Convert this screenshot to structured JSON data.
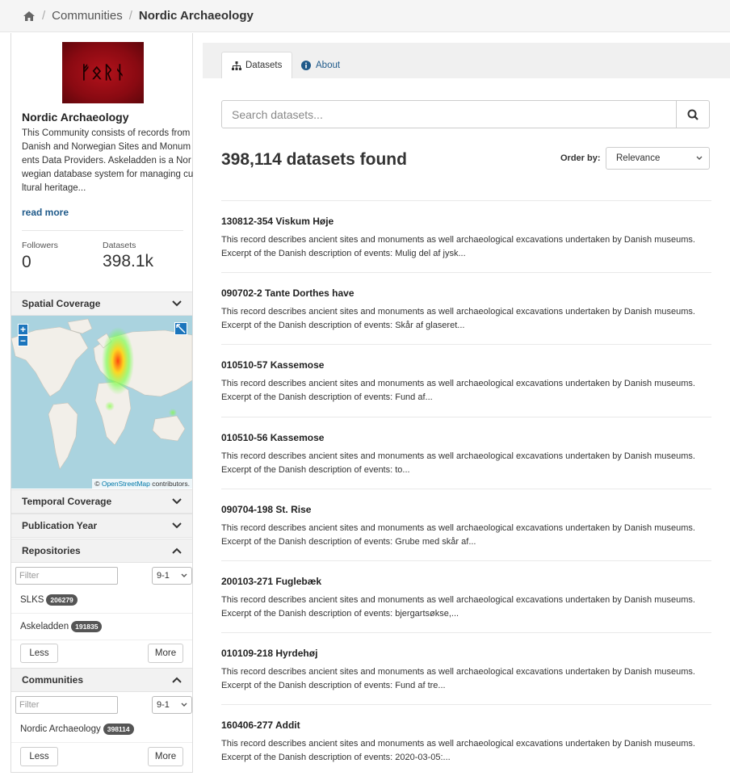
{
  "breadcrumb": {
    "home_icon": "home-icon",
    "items": [
      "Communities",
      "Nordic Archaeology"
    ]
  },
  "community": {
    "logo_text": "ᚠᛟᚱᚾ",
    "title": "Nordic Archaeology",
    "description": "This Community consists of records from Danish and Norwegian Sites and Monuments Data Providers. Askeladden is a Norwegian database system for managing cultural heritage...",
    "read_more": "read more",
    "followers_label": "Followers",
    "followers_value": "0",
    "datasets_label": "Datasets",
    "datasets_value": "398.1k"
  },
  "facets": {
    "spatial": "Spatial Coverage",
    "map_zoom_in": "+",
    "map_zoom_out": "−",
    "map_credit_link": "OpenStreetMap",
    "map_credit_suffix": " contributors.",
    "temporal": "Temporal Coverage",
    "publication_year": "Publication Year",
    "repositories": {
      "label": "Repositories",
      "filter_placeholder": "Filter",
      "sort_value": "9-1",
      "items": [
        {
          "name": "SLKS",
          "count": "206279"
        },
        {
          "name": "Askeladden",
          "count": "191835"
        }
      ],
      "less": "Less",
      "more": "More"
    },
    "communities": {
      "label": "Communities",
      "filter_placeholder": "Filter",
      "sort_value": "9-1",
      "items": [
        {
          "name": "Nordic Archaeology",
          "count": "398114"
        }
      ],
      "less": "Less",
      "more": "More"
    }
  },
  "tabs": [
    {
      "label": "Datasets",
      "icon": "sitemap-icon"
    },
    {
      "label": "About",
      "icon": "info-icon"
    }
  ],
  "search": {
    "placeholder": "Search datasets..."
  },
  "results_summary": "398,114 datasets found",
  "order_by": {
    "label": "Order by:",
    "value": "Relevance"
  },
  "results": [
    {
      "title": "130812-354 Viskum Høje",
      "description": "This record describes ancient sites and monuments as well archaeological excavations undertaken by Danish museums. Excerpt of the Danish description of events: Mulig del af jysk..."
    },
    {
      "title": "090702-2 Tante Dorthes have",
      "description": "This record describes ancient sites and monuments as well archaeological excavations undertaken by Danish museums. Excerpt of the Danish description of events: Skår af glaseret..."
    },
    {
      "title": "010510-57 Kassemose",
      "description": "This record describes ancient sites and monuments as well archaeological excavations undertaken by Danish museums. Excerpt of the Danish description of events: Fund af..."
    },
    {
      "title": "010510-56 Kassemose",
      "description": "This record describes ancient sites and monuments as well archaeological excavations undertaken by Danish museums. Excerpt of the Danish description of events: to..."
    },
    {
      "title": "090704-198 St. Rise",
      "description": "This record describes ancient sites and monuments as well archaeological excavations undertaken by Danish museums. Excerpt of the Danish description of events: Grube med skår af..."
    },
    {
      "title": "200103-271 Fuglebæk",
      "description": "This record describes ancient sites and monuments as well archaeological excavations undertaken by Danish museums. Excerpt of the Danish description of events: bjergartsøkse,..."
    },
    {
      "title": "010109-218 Hyrdehøj",
      "description": "This record describes ancient sites and monuments as well archaeological excavations undertaken by Danish museums. Excerpt of the Danish description of events: Fund af tre..."
    },
    {
      "title": "160406-277 Addit",
      "description": "This record describes ancient sites and monuments as well archaeological excavations undertaken by Danish museums. Excerpt of the Danish description of events: 2020-03-05:..."
    }
  ]
}
